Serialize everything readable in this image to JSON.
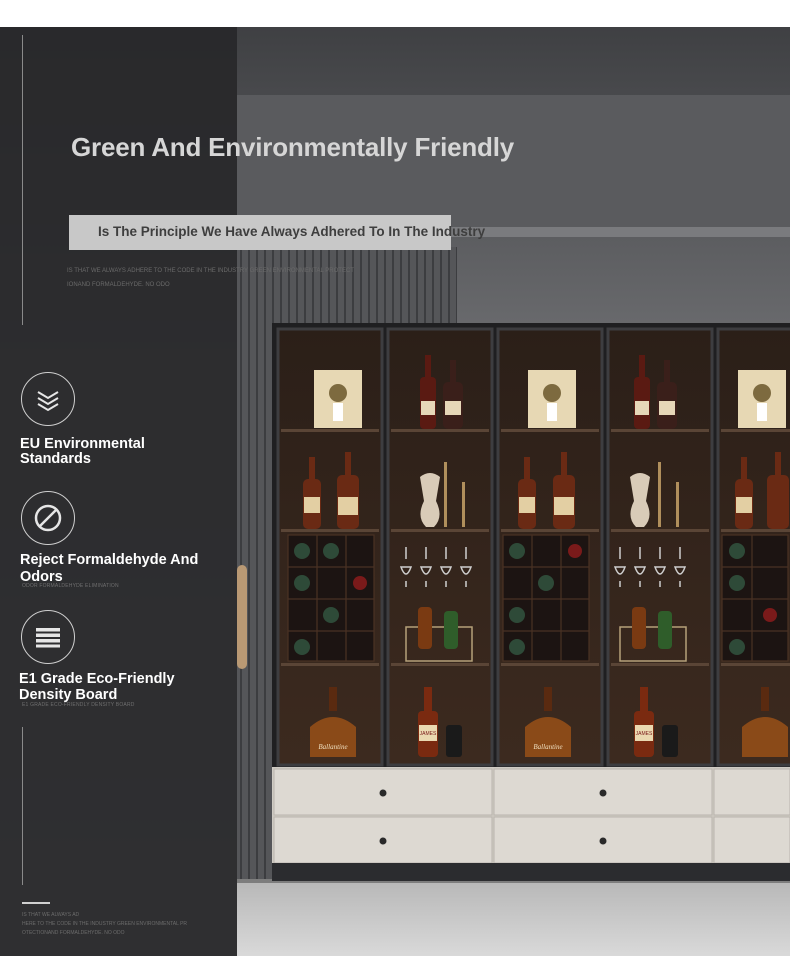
{
  "heading": "Green And Environmentally Friendly",
  "subtitle": "Is The Principle We Have Always Adhered To In The Industry",
  "fine_print_lines": [
    "IS THAT WE ALWAYS ADHERE TO THE CODE IN THE INDUSTRY GREEN ENVIRONMENTAL PROTECT",
    "IONAND FORMALDEHYDE. NO ODO"
  ],
  "features": [
    {
      "label_line1": "EU Environmental",
      "label_line2": "Standards",
      "icon": "layers-icon",
      "tiny": ""
    },
    {
      "label_line1": "Reject Formaldehyde And",
      "label_line2": "Odors",
      "icon": "prohibited-icon",
      "tiny": "ODOR FORMALDEHYDE ELIMINATION"
    },
    {
      "label_line1": "E1 Grade Eco-Friendly",
      "label_line2": "Density Board",
      "icon": "density-board-icon",
      "tiny": "E1 GRADE ECO-FRIENDLY DENSITY BOARD"
    }
  ],
  "footer_lines": [
    "IS THAT WE ALWAYS AD",
    "HERE TO THE CODE IN THE INDUSTRY GREEN ENVIRONMENTAL PR",
    "OTECTIONAND FORMALDEHYDE. NO ODO"
  ],
  "bottle_labels": [
    "JAMES",
    "Ballantine"
  ],
  "colors": {
    "sidebar": "#28282a",
    "cabinet_frame": "#2a2a2c",
    "cabinet_interior": "#3a2a20",
    "drawer": "#dcd8d2",
    "floor": "#c9c9c9",
    "heading": "#d6d6d6"
  }
}
